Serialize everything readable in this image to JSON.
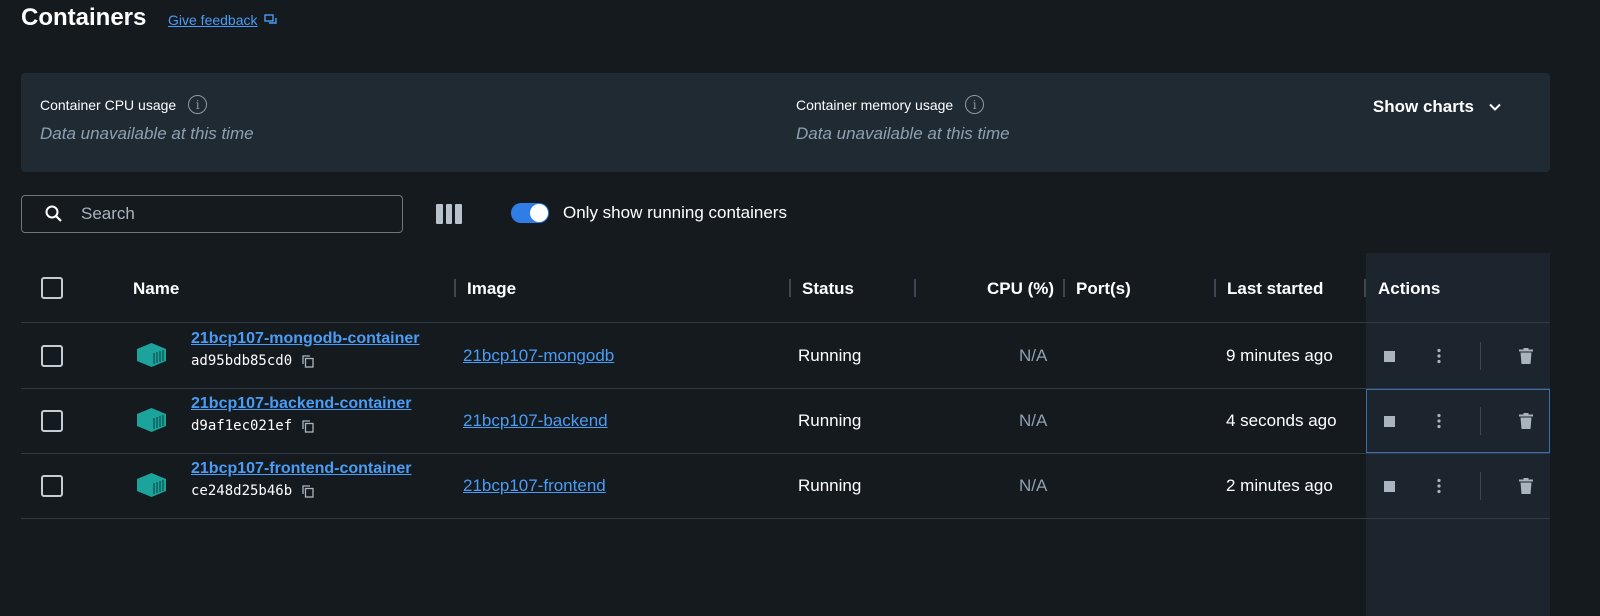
{
  "header": {
    "title": "Containers",
    "feedback_label": "Give feedback"
  },
  "stats": {
    "cpu_label": "Container CPU usage",
    "cpu_value": "Data unavailable at this time",
    "memory_label": "Container memory usage",
    "memory_value": "Data unavailable at this time",
    "show_charts_label": "Show charts"
  },
  "toolbar": {
    "search_placeholder": "Search",
    "toggle_label": "Only show running containers",
    "toggle_on": true
  },
  "table": {
    "columns": {
      "name": "Name",
      "image": "Image",
      "status": "Status",
      "cpu": "CPU (%)",
      "ports": "Port(s)",
      "last_started": "Last started",
      "actions": "Actions"
    },
    "rows": [
      {
        "name": "21bcp107-mongodb-container",
        "id": "ad95bdb85cd0",
        "image": "21bcp107-mongodb",
        "status": "Running",
        "cpu": "N/A",
        "ports": "",
        "last_started": "9 minutes ago"
      },
      {
        "name": "21bcp107-backend-container",
        "id": "d9af1ec021ef",
        "image": "21bcp107-backend",
        "status": "Running",
        "cpu": "N/A",
        "ports": "",
        "last_started": "4 seconds ago"
      },
      {
        "name": "21bcp107-frontend-container",
        "id": "ce248d25b46b",
        "image": "21bcp107-frontend",
        "status": "Running",
        "cpu": "N/A",
        "ports": "",
        "last_started": "2 minutes ago"
      }
    ]
  },
  "colors": {
    "accent": "#4a9cf5",
    "container_icon": "#1ba39c",
    "toggle": "#2f7ee6"
  },
  "icons": {
    "feedback": "chat-bubbles-icon",
    "info": "info-icon",
    "chevron": "chevron-down-icon",
    "search": "search-icon",
    "columns": "column-view-icon",
    "container": "container-icon",
    "copy": "copy-icon",
    "stop": "stop-icon",
    "more": "more-vertical-icon",
    "delete": "trash-icon"
  }
}
